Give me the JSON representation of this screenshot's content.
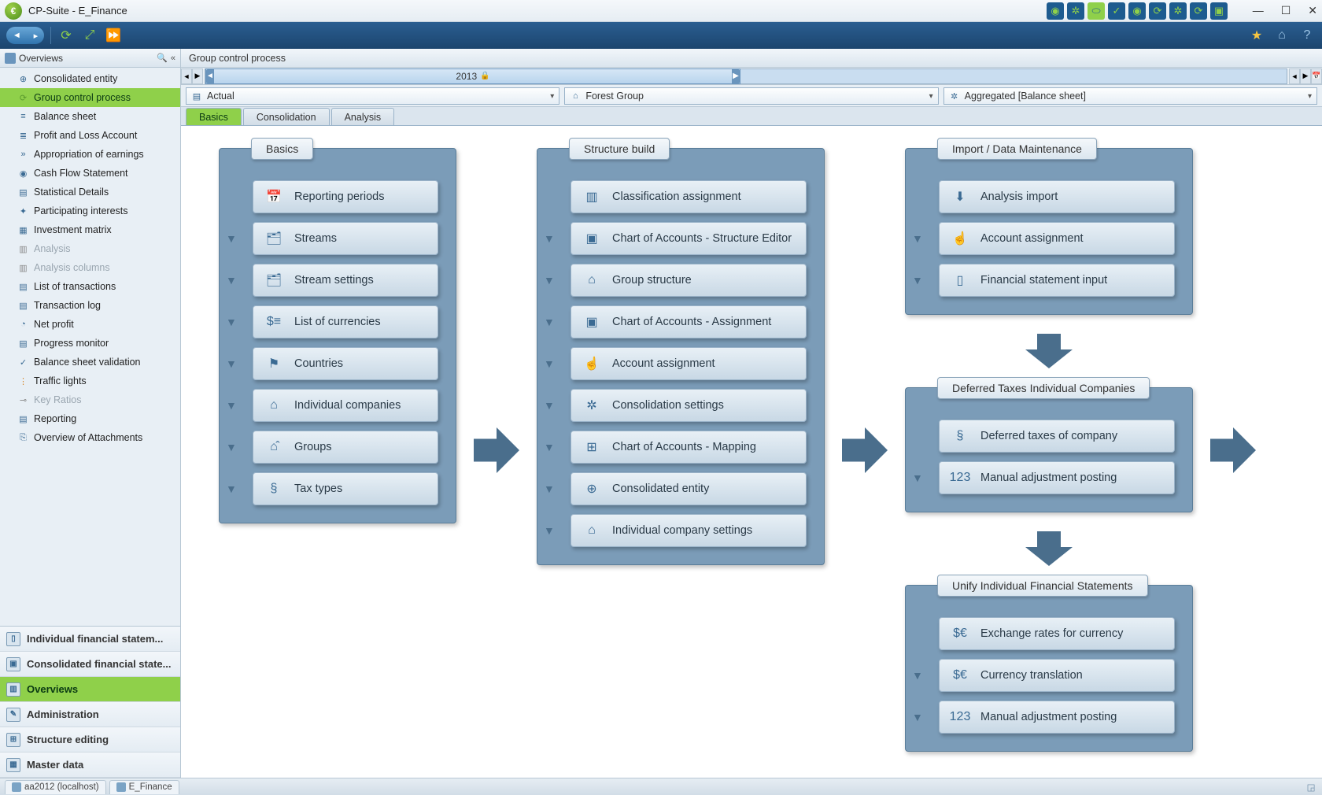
{
  "app": {
    "title": "CP-Suite - E_Finance"
  },
  "toolbar": {},
  "sidebar": {
    "header": "Overviews",
    "items": [
      {
        "label": "Consolidated entity",
        "icon": "⊕",
        "cls": "ic-blue"
      },
      {
        "label": "Group control process",
        "icon": "⟳",
        "cls": "ic-green",
        "selected": true
      },
      {
        "label": "Balance sheet",
        "icon": "≡",
        "cls": "ic-blue"
      },
      {
        "label": "Profit and Loss Account",
        "icon": "≣",
        "cls": "ic-blue"
      },
      {
        "label": "Appropriation of earnings",
        "icon": "»",
        "cls": "ic-blue"
      },
      {
        "label": "Cash Flow Statement",
        "icon": "◉",
        "cls": "ic-blue"
      },
      {
        "label": "Statistical Details",
        "icon": "▤",
        "cls": "ic-blue"
      },
      {
        "label": "Participating interests",
        "icon": "✦",
        "cls": "ic-blue"
      },
      {
        "label": "Investment matrix",
        "icon": "▦",
        "cls": "ic-blue"
      },
      {
        "label": "Analysis",
        "icon": "▥",
        "cls": "ic-gray",
        "disabled": true
      },
      {
        "label": "Analysis columns",
        "icon": "▥",
        "cls": "ic-gray",
        "disabled": true
      },
      {
        "label": "List of transactions",
        "icon": "▤",
        "cls": "ic-blue"
      },
      {
        "label": "Transaction log",
        "icon": "▤",
        "cls": "ic-blue"
      },
      {
        "label": "Net profit",
        "icon": "◔",
        "cls": "ic-blue"
      },
      {
        "label": "Progress monitor",
        "icon": "▤",
        "cls": "ic-blue"
      },
      {
        "label": "Balance sheet validation",
        "icon": "✓",
        "cls": "ic-blue"
      },
      {
        "label": "Traffic lights",
        "icon": "⋮",
        "cls": "ic-orange"
      },
      {
        "label": "Key Ratios",
        "icon": "⊸",
        "cls": "ic-gray",
        "disabled": true
      },
      {
        "label": "Reporting",
        "icon": "▤",
        "cls": "ic-blue"
      },
      {
        "label": "Overview of Attachments",
        "icon": "⎘",
        "cls": "ic-blue"
      }
    ],
    "bottom": [
      {
        "label": "Individual financial statem...",
        "icon": "▯"
      },
      {
        "label": "Consolidated financial state...",
        "icon": "▣"
      },
      {
        "label": "Overviews",
        "icon": "▥",
        "active": true
      },
      {
        "label": "Administration",
        "icon": "✎"
      },
      {
        "label": "Structure editing",
        "icon": "⊞"
      },
      {
        "label": "Master data",
        "icon": "▦"
      }
    ]
  },
  "breadcrumb": "Group control process",
  "timeline": {
    "year": "2013"
  },
  "filters": {
    "f1": "Actual",
    "f2": "Forest Group",
    "f3": "Aggregated [Balance sheet]"
  },
  "tabs": [
    {
      "label": "Basics",
      "active": true
    },
    {
      "label": "Consolidation"
    },
    {
      "label": "Analysis"
    }
  ],
  "flow": {
    "col1": {
      "title": "Basics",
      "cards": [
        {
          "label": "Reporting periods",
          "icon": "📅"
        },
        {
          "label": "Streams",
          "icon": "🗂"
        },
        {
          "label": "Stream settings",
          "icon": "🗂"
        },
        {
          "label": "List of currencies",
          "icon": "$≡"
        },
        {
          "label": "Countries",
          "icon": "⚑"
        },
        {
          "label": "Individual companies",
          "icon": "⌂"
        },
        {
          "label": "Groups",
          "icon": "⌂̂"
        },
        {
          "label": "Tax types",
          "icon": "§"
        }
      ]
    },
    "col2": {
      "title": "Structure build",
      "cards": [
        {
          "label": "Classification assignment",
          "icon": "▥"
        },
        {
          "label": "Chart of Accounts - Structure Editor",
          "icon": "▣"
        },
        {
          "label": "Group structure",
          "icon": "⌂"
        },
        {
          "label": "Chart of Accounts - Assignment",
          "icon": "▣"
        },
        {
          "label": "Account assignment",
          "icon": "☝"
        },
        {
          "label": "Consolidation settings",
          "icon": "✲"
        },
        {
          "label": "Chart of Accounts - Mapping",
          "icon": "⊞"
        },
        {
          "label": "Consolidated entity",
          "icon": "⊕"
        },
        {
          "label": "Individual company settings",
          "icon": "⌂"
        }
      ]
    },
    "col3a": {
      "title": "Import / Data Maintenance",
      "cards": [
        {
          "label": "Analysis import",
          "icon": "⬇"
        },
        {
          "label": "Account assignment",
          "icon": "☝"
        },
        {
          "label": "Financial statement input",
          "icon": "▯"
        }
      ]
    },
    "col3b": {
      "title": "Deferred Taxes Individual Companies",
      "cards": [
        {
          "label": "Deferred taxes of company",
          "icon": "§"
        },
        {
          "label": "Manual adjustment posting",
          "icon": "123"
        }
      ]
    },
    "col3c": {
      "title": "Unify Individual Financial Statements",
      "cards": [
        {
          "label": "Exchange rates for currency",
          "icon": "$€"
        },
        {
          "label": "Currency translation",
          "icon": "$€"
        },
        {
          "label": "Manual adjustment posting",
          "icon": "123"
        }
      ]
    }
  },
  "status": {
    "tab1": "aa2012 (localhost)",
    "tab2": "E_Finance"
  }
}
